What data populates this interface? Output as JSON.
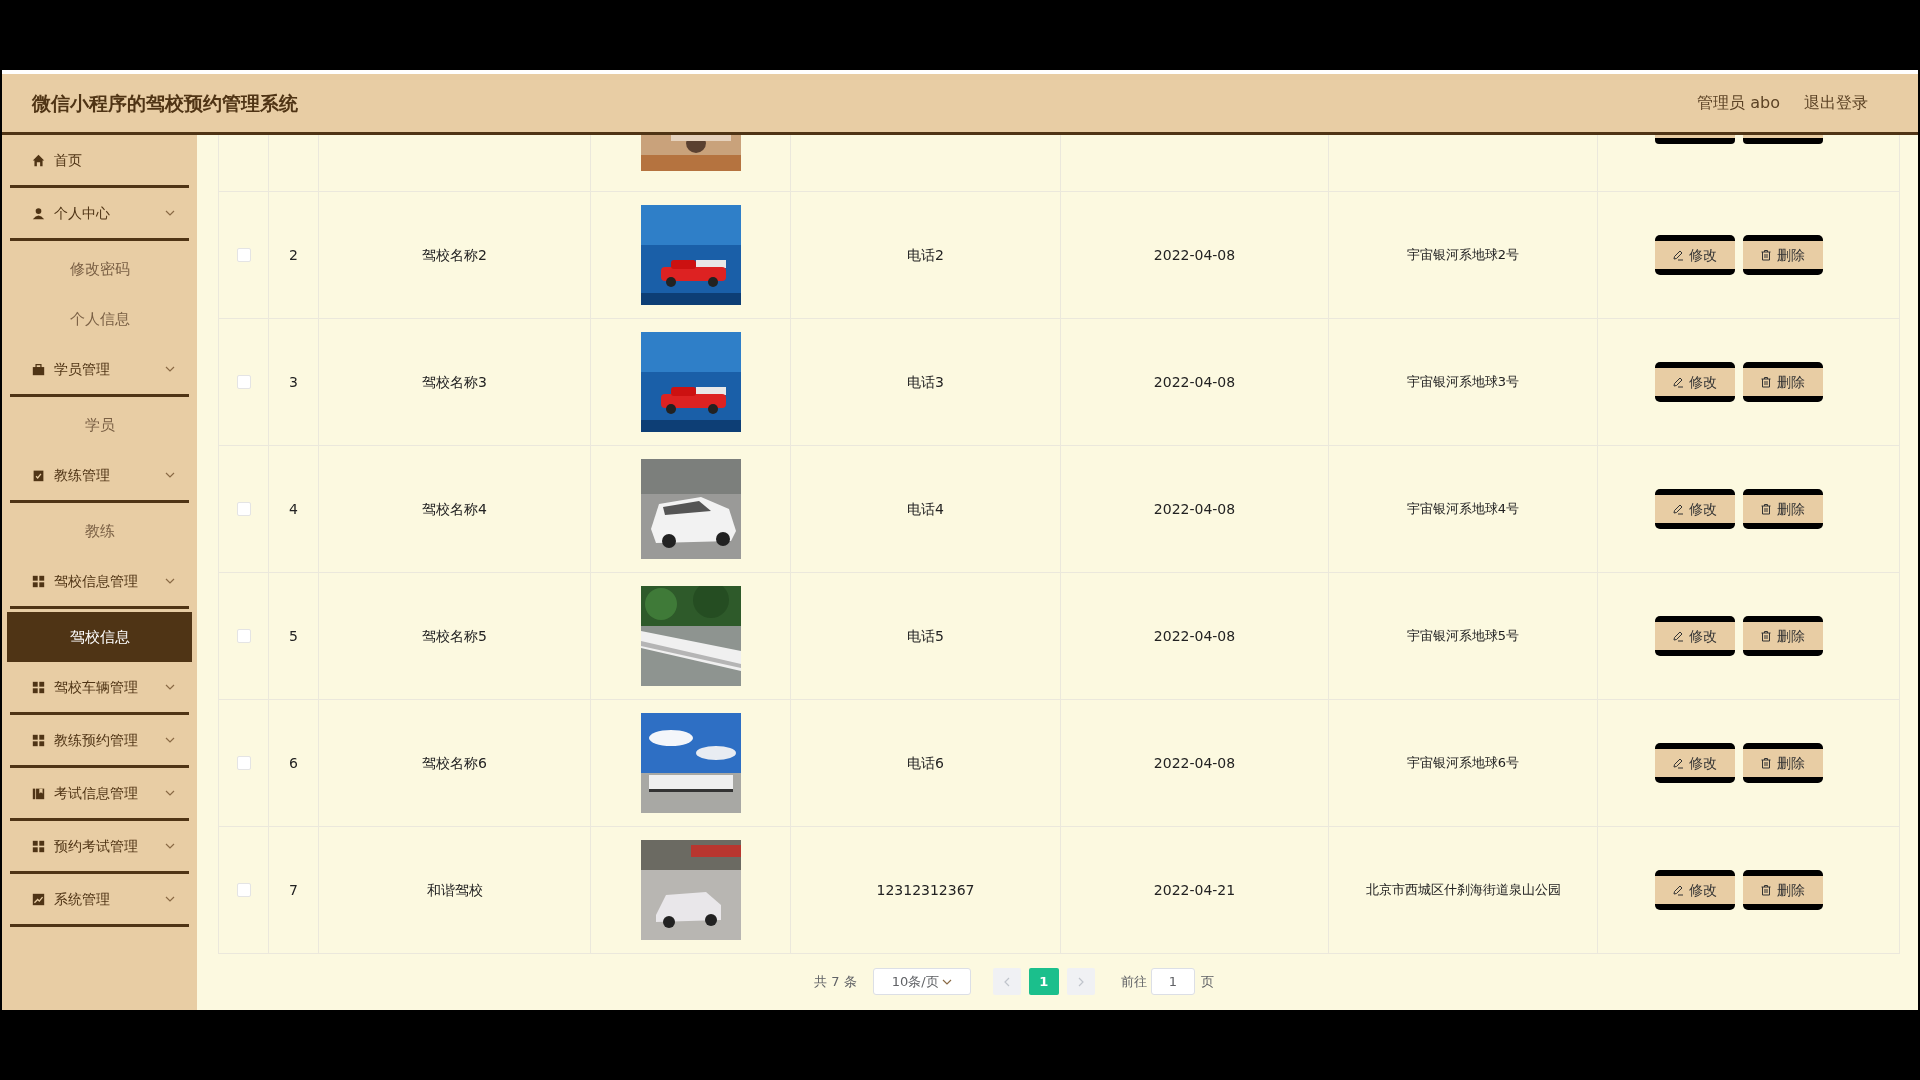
{
  "header": {
    "title": "微信小程序的驾校预约管理系统",
    "user": "管理员 abo",
    "logout": "退出登录"
  },
  "sidebar": {
    "items": [
      {
        "kind": "home",
        "label": "首页"
      },
      {
        "kind": "user",
        "label": "个人中心",
        "children": [
          {
            "label": "修改密码",
            "selected": false
          },
          {
            "label": "个人信息",
            "selected": false
          }
        ]
      },
      {
        "kind": "briefcase",
        "label": "学员管理",
        "children": [
          {
            "label": "学员",
            "selected": false
          }
        ]
      },
      {
        "kind": "clipboard",
        "label": "教练管理",
        "children": [
          {
            "label": "教练",
            "selected": false
          }
        ]
      },
      {
        "kind": "grid",
        "label": "驾校信息管理",
        "children": [
          {
            "label": "驾校信息",
            "selected": true
          }
        ]
      },
      {
        "kind": "grid",
        "label": "驾校车辆管理"
      },
      {
        "kind": "grid",
        "label": "教练预约管理"
      },
      {
        "kind": "book",
        "label": "考试信息管理"
      },
      {
        "kind": "grid",
        "label": "预约考试管理"
      },
      {
        "kind": "chart",
        "label": "系统管理"
      }
    ]
  },
  "table": {
    "rows": [
      {
        "checked": false,
        "index": "2",
        "name": "驾校名称2",
        "phone": "电话2",
        "date": "2022-04-08",
        "address": "宇宙银河系地球2号",
        "actions": [
          "修改",
          "删除"
        ]
      },
      {
        "checked": false,
        "index": "3",
        "name": "驾校名称3",
        "phone": "电话3",
        "date": "2022-04-08",
        "address": "宇宙银河系地球3号",
        "actions": [
          "修改",
          "删除"
        ]
      },
      {
        "checked": false,
        "index": "4",
        "name": "驾校名称4",
        "phone": "电话4",
        "date": "2022-04-08",
        "address": "宇宙银河系地球4号",
        "actions": [
          "修改",
          "删除"
        ]
      },
      {
        "checked": false,
        "index": "5",
        "name": "驾校名称5",
        "phone": "电话5",
        "date": "2022-04-08",
        "address": "宇宙银河系地球5号",
        "actions": [
          "修改",
          "删除"
        ]
      },
      {
        "checked": false,
        "index": "6",
        "name": "驾校名称6",
        "phone": "电话6",
        "date": "2022-04-08",
        "address": "宇宙银河系地球6号",
        "actions": [
          "修改",
          "删除"
        ]
      },
      {
        "checked": false,
        "index": "7",
        "name": "和谐驾校",
        "phone": "12312312367",
        "date": "2022-04-21",
        "address": "北京市西城区什刹海街道泉山公园",
        "actions": [
          "修改",
          "删除"
        ]
      }
    ]
  },
  "pagination": {
    "total": "共 7 条",
    "page_size": "10条/页",
    "pages": [
      {
        "label": "1",
        "selected": true
      }
    ],
    "goto_label": "前往",
    "goto_value": "1",
    "goto_suffix": "页"
  }
}
